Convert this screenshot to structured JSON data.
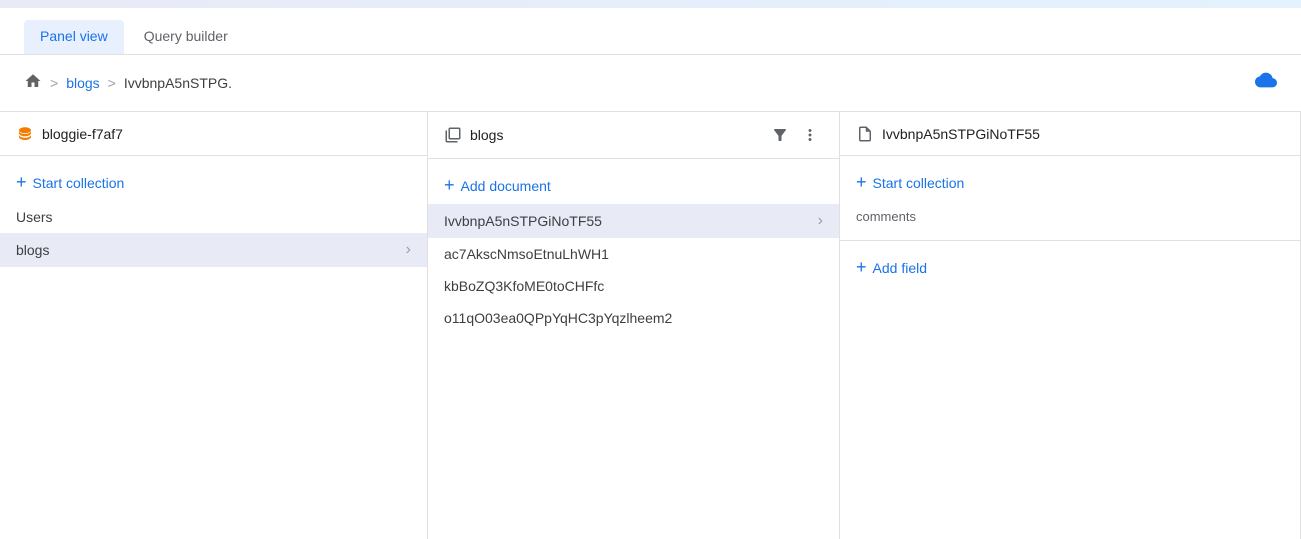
{
  "topbar": {},
  "tabs": [
    {
      "id": "panel-view",
      "label": "Panel view",
      "active": true
    },
    {
      "id": "query-builder",
      "label": "Query builder",
      "active": false
    }
  ],
  "breadcrumb": {
    "home_label": "Home",
    "items": [
      "blogs",
      "IvvbnpA5nSTPG."
    ]
  },
  "panels": {
    "left": {
      "icon": "database-icon",
      "title": "bloggie-f7af7",
      "items": [
        {
          "id": "users",
          "label": "Users",
          "active": false,
          "has_children": false
        },
        {
          "id": "blogs",
          "label": "blogs",
          "active": true,
          "has_children": true
        }
      ],
      "start_collection_label": "Start collection"
    },
    "middle": {
      "icon": "collection-icon",
      "title": "blogs",
      "add_document_label": "Add document",
      "items": [
        {
          "id": "IvvbnpA5nSTPGiNoTF55",
          "label": "IvvbnpA5nSTPGiNoTF55",
          "active": true,
          "has_children": true
        },
        {
          "id": "ac7AkscNmsoEtnuLhWH1",
          "label": "ac7AkscNmsoEtnuLhWH1",
          "active": false,
          "has_children": false
        },
        {
          "id": "kbBoZQ3KfoME0toCHFfc",
          "label": "kbBoZQ3KfoME0toCHFfc",
          "active": false,
          "has_children": false
        },
        {
          "id": "o11qO03ea0QPpYqHC3pYqzlheem2",
          "label": "o11qO03ea0QPpYqHC3pYqzlheem2",
          "active": false,
          "has_children": false
        }
      ]
    },
    "right": {
      "icon": "document-icon",
      "title": "IvvbnpA5nSTPGiNoTF55",
      "start_collection_label": "Start collection",
      "subcollections": [
        {
          "id": "comments",
          "label": "comments"
        }
      ],
      "add_field_label": "Add field"
    }
  },
  "icons": {
    "plus": "+",
    "chevron_right": "›",
    "home": "⌂",
    "sep": ">",
    "cloud": "☁",
    "filter": "≡",
    "more": "⋮"
  }
}
